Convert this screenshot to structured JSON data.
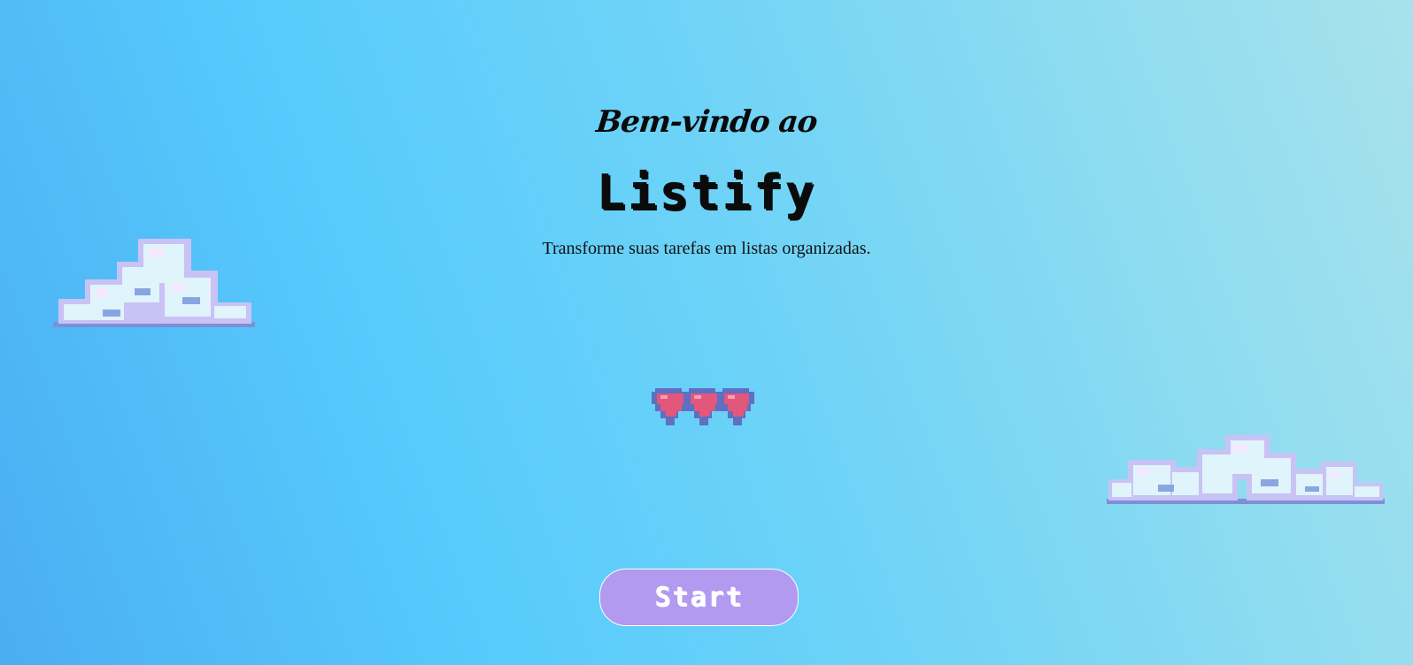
{
  "welcome_text": "Bem-vindo ao",
  "brand_name": "Listify",
  "tagline": "Transforme suas tarefas em listas organizadas.",
  "start_button_label": "Start",
  "icons": {
    "cloud_left": "cloud-icon",
    "cloud_right": "cloud-icon",
    "hearts": "hearts-icon"
  },
  "colors": {
    "background_start": "#4aaef2",
    "background_end": "#a8e2ec",
    "button": "#b19aef",
    "heart": "#e85a7a",
    "cloud": "#d8f0fb"
  }
}
